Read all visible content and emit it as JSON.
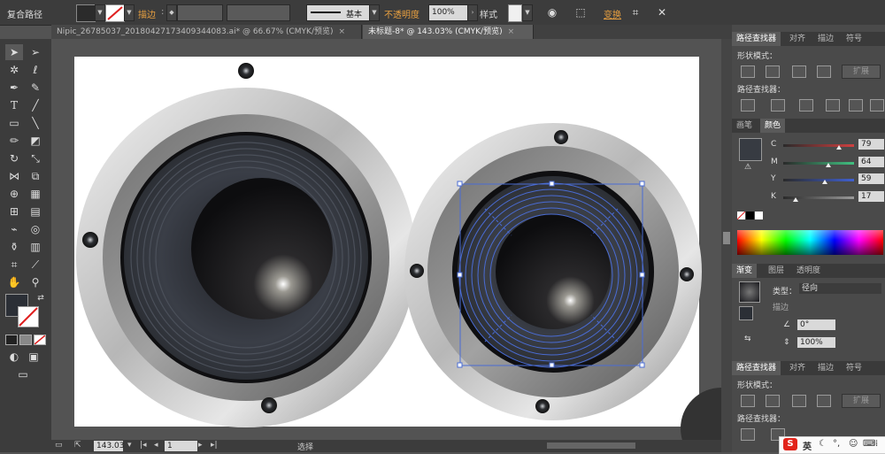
{
  "control_bar": {
    "object_type": "复合路径",
    "stroke_label": "描边",
    "stroke_style": "基本",
    "opacity_label": "不透明度",
    "opacity_value": "100%",
    "style_label": "样式",
    "transform_label": "变换"
  },
  "tabs": [
    {
      "label": "Nipic_26785037_20180427173409344083.ai* @ 66.67% (CMYK/预览)",
      "close": "×"
    },
    {
      "label": "未标题-8* @ 143.03% (CMYK/预览)",
      "close": "×"
    }
  ],
  "status_bar": {
    "zoom": "143.03",
    "page": "1",
    "mode": "选择"
  },
  "pathfinder_panel": {
    "tabs": [
      "路径查找器",
      "对齐",
      "描边",
      "符号"
    ],
    "shape_modes_label": "形状模式：",
    "expand_label": "扩展",
    "pathfinders_label": "路径查找器："
  },
  "color_panel": {
    "tabs": [
      "画笔",
      "颜色"
    ],
    "channels": [
      {
        "letter": "C",
        "value": "79",
        "level": 0.79,
        "gradient": [
          "#2a2a2a",
          "#d04040"
        ]
      },
      {
        "letter": "M",
        "value": "64",
        "level": 0.64,
        "gradient": [
          "#2a2a2a",
          "#40c080"
        ]
      },
      {
        "letter": "Y",
        "value": "59",
        "level": 0.59,
        "gradient": [
          "#2a2a2a",
          "#4060d0"
        ]
      },
      {
        "letter": "K",
        "value": "17",
        "level": 0.17,
        "gradient": [
          "#2a2a2a",
          "#999999"
        ]
      }
    ],
    "swatch_color": "#373b42"
  },
  "gradient_panel": {
    "tabs": [
      "渐变",
      "图层",
      "透明度"
    ],
    "type_label": "类型：",
    "type_value": "径向",
    "stroke_label": "描边",
    "angle_value": "0°",
    "ratio_value": "100%"
  },
  "pathfinder_panel_2": {
    "tabs": [
      "路径查找器",
      "对齐",
      "描边",
      "符号"
    ],
    "shape_modes_label": "形状模式：",
    "expand_label": "扩展",
    "pathfinders_label": "路径查找器："
  },
  "ime_bar": {
    "logo": "S",
    "lang": "英",
    "icons": [
      "moon-icon",
      "punctuation-icon",
      "smile-icon",
      "keyboard-icon",
      "grid-icon"
    ]
  },
  "colors": {
    "selection": "#4a6cd4",
    "accent_orange": "#e8a040",
    "panel_bg": "#4a4a4a"
  }
}
